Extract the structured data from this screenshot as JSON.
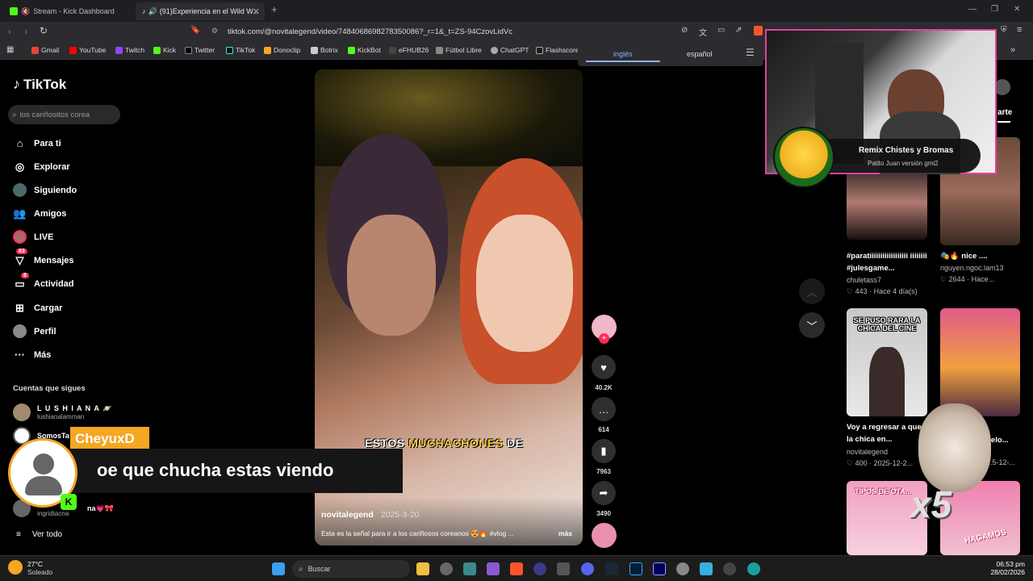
{
  "browser": {
    "tabs": [
      {
        "label": "Stream - Kick Dashboard"
      },
      {
        "label": "(91)Experiencia en el Wild W..."
      }
    ],
    "url": "tiktok.com/@novitalegend/video/7484068698278350086?_r=1&_t=ZS-94CzovLidVc",
    "bookmarks": [
      "Gmail",
      "YouTube",
      "Twitch",
      "Kick",
      "Twitter",
      "TikTok",
      "Donoclip",
      "Botrix",
      "KickBot",
      "eFHUB26",
      "Fútbol Libre",
      "ChatGPT",
      "Flashscore"
    ]
  },
  "translate": {
    "from": "inglés",
    "to": "español"
  },
  "tiktok": {
    "logo": "TikTok",
    "search_placeholder": "los cariñositos corea",
    "nav": [
      {
        "label": "Para ti",
        "icon": "home-icon"
      },
      {
        "label": "Explorar",
        "icon": "compass-icon"
      },
      {
        "label": "Siguiendo",
        "icon": "following-icon"
      },
      {
        "label": "Amigos",
        "icon": "friends-icon"
      },
      {
        "label": "LIVE",
        "icon": "live-icon"
      },
      {
        "label": "Mensajes",
        "icon": "messages-icon",
        "badge": "83"
      },
      {
        "label": "Actividad",
        "icon": "activity-icon",
        "badge": "8"
      },
      {
        "label": "Cargar",
        "icon": "upload-icon"
      },
      {
        "label": "Perfil",
        "icon": "profile-icon"
      },
      {
        "label": "Más",
        "icon": "more-icon"
      }
    ],
    "following_title": "Cuentas que sigues",
    "following": [
      {
        "name": "L U S H I A N A 🪐",
        "handle": "lushianalamman"
      },
      {
        "name": "SomosTa",
        "handle": ""
      },
      {
        "name": "na💗🎀",
        "handle": "ingridtacna"
      }
    ],
    "see_all": "Ver todo"
  },
  "video": {
    "caption_overlay_1": "ESTOS",
    "caption_overlay_2": "MUCHACHONES",
    "caption_overlay_3": "DE",
    "author": "novitalegend",
    "date": "2025-3-20",
    "description": "Esta es la señal para ir a los cariñosos coreanos 😍🔥 #vlog ...",
    "more": "más",
    "likes": "40.2K",
    "comments": "614",
    "saves": "7963",
    "shares": "3490"
  },
  "related": [
    {
      "title": "#paratiiiiiiiiiiiiiiiiii iiiiiiii #julesgame...",
      "author": "chuletass7",
      "stats": "443 · Hace 4 día(s)"
    },
    {
      "title": "🎭🔥 nice ....",
      "author": "nguyen.ngoc.lam13",
      "stats": "2644 · Hace..."
    },
    {
      "title": "Voy a regresar a que la chica en...",
      "author": "novitalegend",
      "stats": "400 · 2025-12-2...",
      "thumb_text": "SE PUSO RARA LA CHICA DEL CINE"
    },
    {
      "title": "...elo...",
      "author": "",
      "stats": "...5-12-..."
    },
    {
      "thumb_text": "TIPOS DE OTA..."
    },
    {
      "thumb_text": "HAGAMOS"
    }
  ],
  "right_header": "arte",
  "webcam": {
    "song_title": "Remix Chistes y Bromas",
    "song_artist": "Patito Juan versión gmi2"
  },
  "chat_overlay": {
    "username": "CheyuxD",
    "message": "oe que chucha estas viendo"
  },
  "sticker": "x5",
  "taskbar": {
    "weather_temp": "27°C",
    "weather_desc": "Soleado",
    "search": "Buscar",
    "time": "06:53 pm",
    "date": "28/02/2026"
  },
  "colors": {
    "accent": "#fe2c55",
    "kick": "#53fc18",
    "chat_name_bg": "#f5a623"
  }
}
